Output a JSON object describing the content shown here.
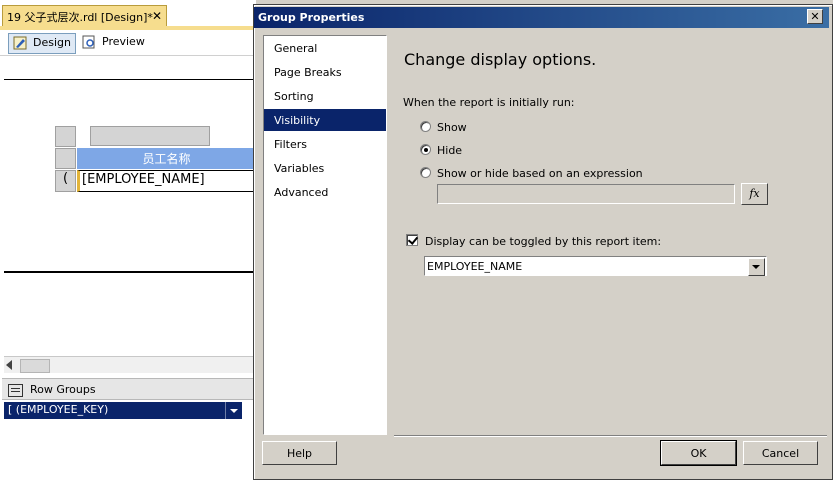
{
  "designer": {
    "doc_tab_title": "19 父子式层次.rdl [Design]*",
    "doc_tab_close": "✕",
    "view_tabs": [
      {
        "label": "Design",
        "active": true
      },
      {
        "label": "Preview",
        "active": false
      }
    ],
    "table": {
      "header_text": "员工名称",
      "data_text": "[EMPLOYEE_NAME]",
      "row_group_marker": "("
    },
    "row_groups": {
      "title": "Row Groups",
      "items": [
        "[ (EMPLOYEE_KEY)"
      ]
    }
  },
  "dialog": {
    "title": "Group Properties",
    "close_label": "✕",
    "nav_items": [
      "General",
      "Page Breaks",
      "Sorting",
      "Visibility",
      "Filters",
      "Variables",
      "Advanced"
    ],
    "selected_nav_index": 3,
    "heading": "Change display options.",
    "initial_prompt": "When the report is initially run:",
    "options": [
      {
        "label": "Show",
        "selected": false
      },
      {
        "label": "Hide",
        "selected": true
      },
      {
        "label": "Show or hide based on an expression",
        "selected": false
      }
    ],
    "expression_value": "",
    "fx_label": "fx",
    "toggle_checkbox": {
      "label": "Display can be toggled by this report item:",
      "checked": true
    },
    "toggle_item": "EMPLOYEE_NAME",
    "buttons": {
      "help": "Help",
      "ok": "OK",
      "cancel": "Cancel"
    }
  },
  "colors": {
    "selection": "#0a246a",
    "title_gradient_start": "#0a246a",
    "table_header": "#7ea7e6",
    "doc_tab": "#f6dd8e"
  }
}
